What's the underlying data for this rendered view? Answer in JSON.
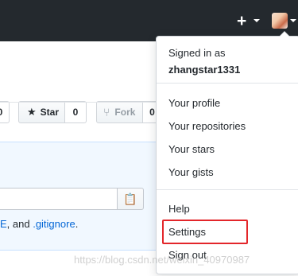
{
  "header": {
    "plus_icon": "plus-icon",
    "avatar_icon": "avatar-image"
  },
  "page": {
    "left_count": "0",
    "star_label": "Star",
    "star_count": "0",
    "fork_label": "Fork",
    "fork_count": "0",
    "hint_prefix": "E",
    "hint_middle": ", and ",
    "hint_link": ".gitignore",
    "hint_suffix": "."
  },
  "dropdown": {
    "signed_in_label": "Signed in as",
    "username": "zhangstar1331",
    "items": [
      {
        "label": "Your profile"
      },
      {
        "label": "Your repositories"
      },
      {
        "label": "Your stars"
      },
      {
        "label": "Your gists"
      },
      {
        "label": "Help"
      },
      {
        "label": "Settings"
      },
      {
        "label": "Sign out"
      }
    ]
  },
  "watermark": "https://blog.csdn.net/weixin_40970987",
  "colors": {
    "header_bg": "#24292e",
    "link": "#0366d6",
    "highlight_border": "#e3262a"
  }
}
